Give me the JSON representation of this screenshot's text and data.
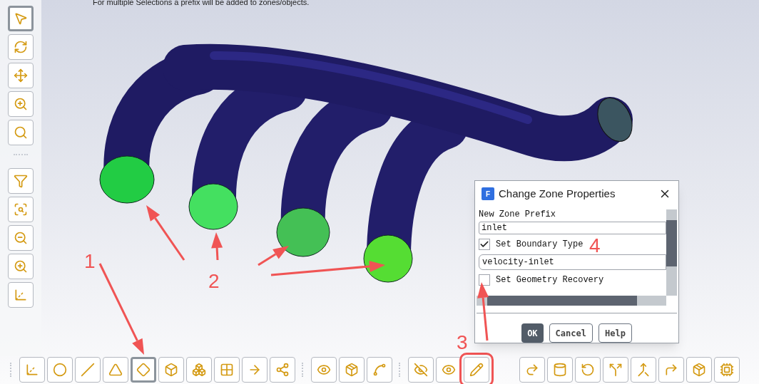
{
  "hint_text": "For multiple Selections a prefix will be added to zones/objects.",
  "left_toolbar": [
    {
      "selected": true
    },
    {
      "selected": false
    },
    {
      "selected": false
    },
    {
      "selected": false
    },
    {
      "selected": false
    },
    {
      "selected": false
    },
    {
      "selected": false
    },
    {
      "selected": false
    },
    {
      "selected": false
    },
    {
      "selected": false
    }
  ],
  "bottom_toolbar": [
    [
      {
        "selected": false,
        "annotated": false
      },
      {
        "selected": false,
        "annotated": false
      },
      {
        "selected": false,
        "annotated": false
      },
      {
        "selected": false,
        "annotated": false
      },
      {
        "selected": true,
        "annotated": false
      },
      {
        "selected": false,
        "annotated": false
      },
      {
        "selected": false,
        "annotated": false
      },
      {
        "selected": false,
        "annotated": false
      },
      {
        "selected": false,
        "annotated": false
      },
      {
        "selected": false,
        "annotated": false
      }
    ],
    [
      {
        "selected": false,
        "annotated": false
      },
      {
        "selected": false,
        "annotated": false
      },
      {
        "selected": false,
        "annotated": false
      }
    ],
    [
      {
        "selected": false,
        "annotated": false
      },
      {
        "selected": false,
        "annotated": false
      },
      {
        "selected": false,
        "annotated": true
      }
    ],
    [
      {
        "selected": false,
        "annotated": false
      },
      {
        "selected": false,
        "annotated": false
      },
      {
        "selected": false,
        "annotated": false
      },
      {
        "selected": false,
        "annotated": false
      },
      {
        "selected": false,
        "annotated": false
      },
      {
        "selected": false,
        "annotated": false
      },
      {
        "selected": false,
        "annotated": false
      },
      {
        "selected": false,
        "annotated": false
      }
    ]
  ],
  "dialog": {
    "app_icon_letter": "F",
    "title": "Change Zone Properties",
    "prefix_label": "New Zone Prefix",
    "prefix_value": "inlet",
    "boundary_type": {
      "label": "Set Boundary Type",
      "checked": true
    },
    "boundary_value": "velocity-inlet",
    "geometry_recovery": {
      "label": "Set Geometry Recovery",
      "checked": false
    },
    "buttons": [
      {
        "label": "OK",
        "primary": true
      },
      {
        "label": "Cancel",
        "primary": false
      },
      {
        "label": "Help",
        "primary": false
      }
    ]
  },
  "annotations": [
    {
      "label": "1"
    },
    {
      "label": "2"
    },
    {
      "label": "3"
    },
    {
      "label": "4"
    }
  ]
}
